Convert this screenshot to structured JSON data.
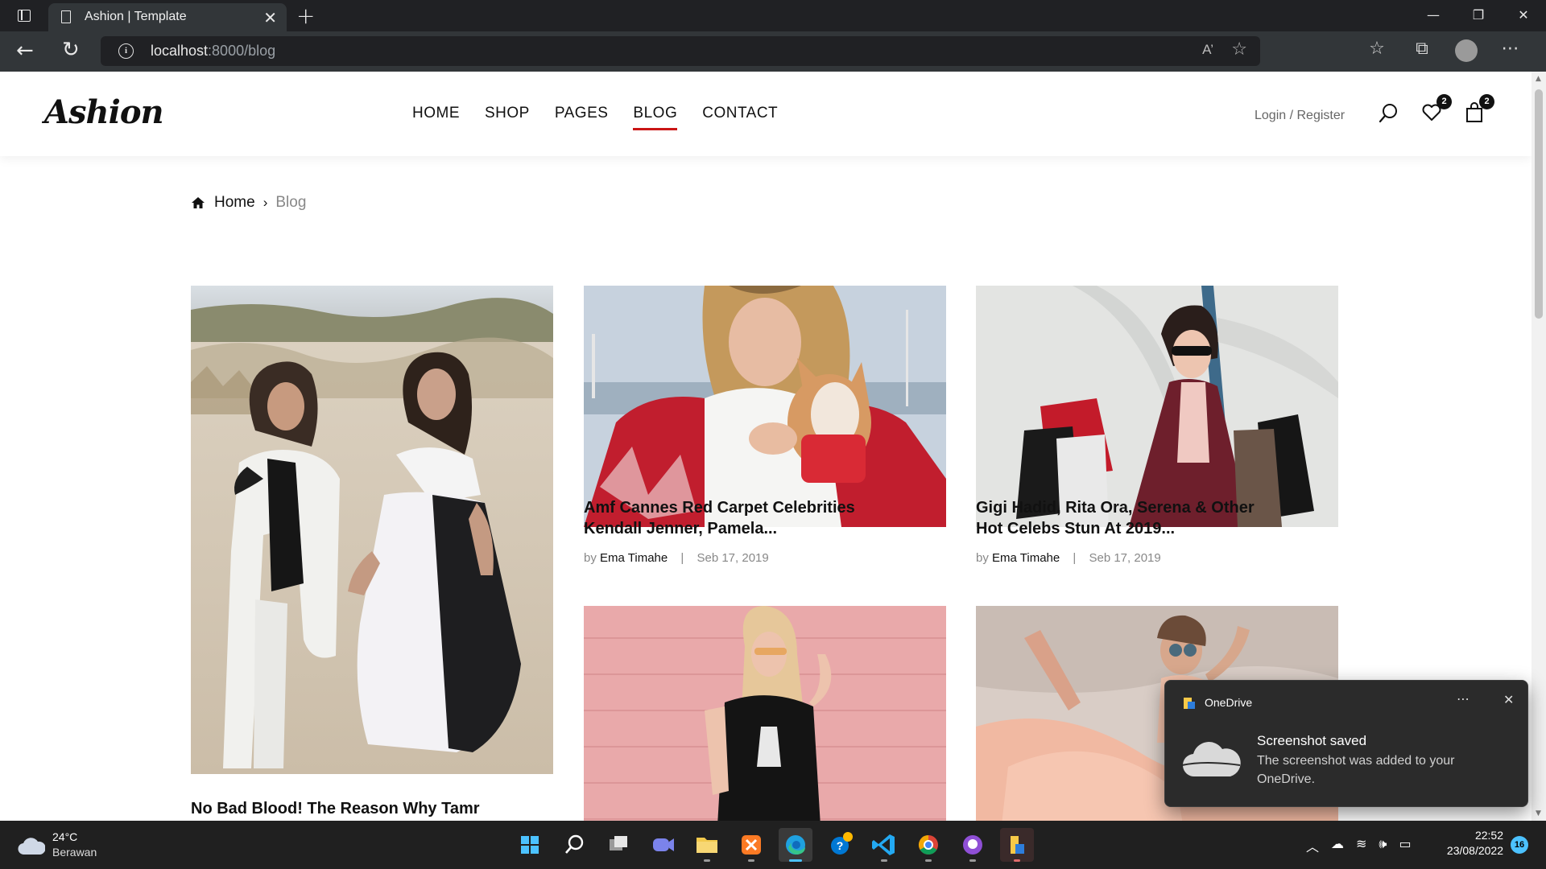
{
  "browser": {
    "tab_title": "Ashion | Template",
    "url_host": "localhost",
    "url_path": ":8000/blog",
    "read_aloud": "A’",
    "window_controls": [
      "—",
      "❐",
      "✕"
    ]
  },
  "site": {
    "logo": "Ashion",
    "nav": [
      "HOME",
      "SHOP",
      "PAGES",
      "BLOG",
      "CONTACT"
    ],
    "active_nav": "BLOG",
    "login": "Login / Register",
    "wishlist_count": "2",
    "cart_count": "2"
  },
  "breadcrumb": {
    "home": "Home",
    "current": "Blog"
  },
  "posts": [
    {
      "title": "No Bad Blood! The Reason Why Tamr",
      "author": "",
      "date": ""
    },
    {
      "title_line1": "Amf Cannes Red Carpet Celebrities",
      "title_line2": "Kendall Jenner, Pamela...",
      "by": "by",
      "author": "Ema Timahe",
      "separator": "|",
      "date": "Seb 17, 2019"
    },
    {
      "title_line1": "Gigi Hadid, Rita Ora, Serena & Other",
      "title_line2": "Hot Celebs Stun At 2019...",
      "by": "by",
      "author": "Ema Timahe",
      "separator": "|",
      "date": "Seb 17, 2019"
    }
  ],
  "toast": {
    "app": "OneDrive",
    "title": "Screenshot saved",
    "message": "The screenshot was added to your OneDrive."
  },
  "taskbar": {
    "temperature": "24°C",
    "weather": "Berawan",
    "time": "22:52",
    "date": "23/08/2022",
    "notifications": "16"
  }
}
